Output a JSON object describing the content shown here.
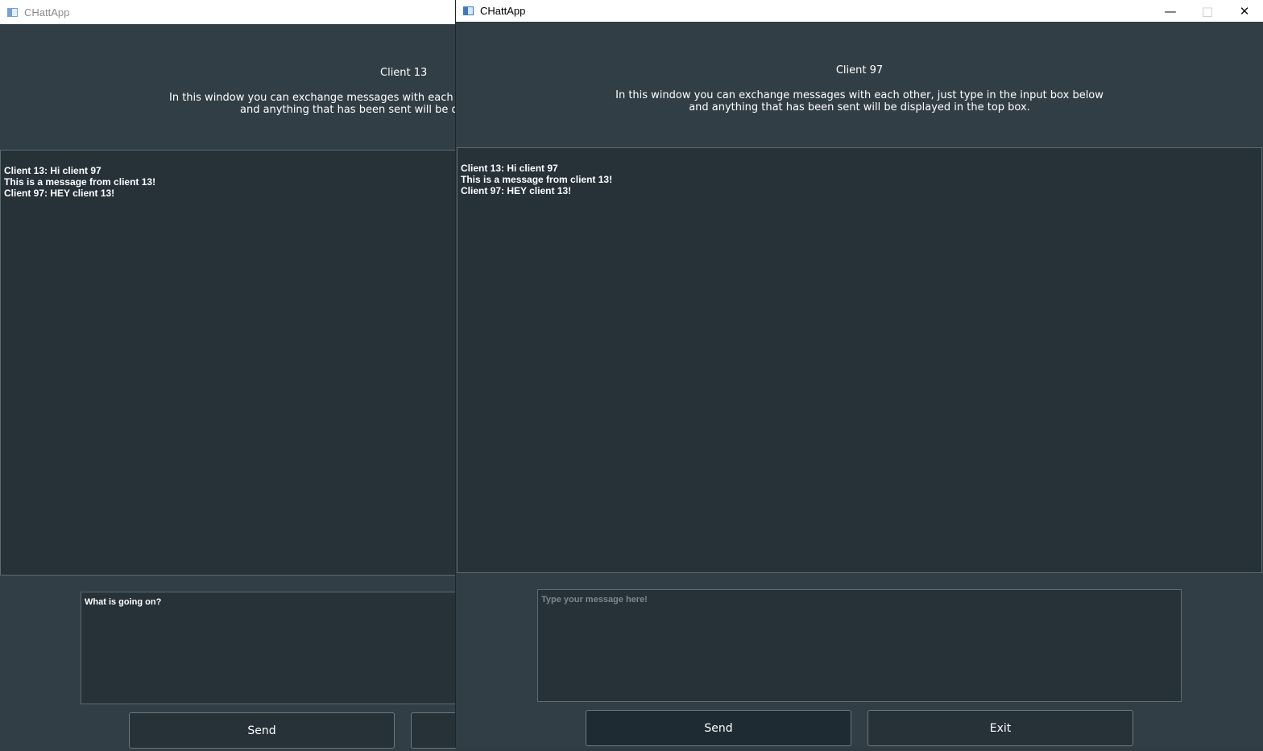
{
  "back_window": {
    "title": "CHattApp",
    "client_label": "Client 13",
    "description_line1": "In this window you can exchange messages with each oth",
    "description_line2": "and anything that has been sent will be dis",
    "messages": [
      "Client 13: Hi client 97",
      "This is a message from client 13!",
      "Client 97: HEY client 13!"
    ],
    "input_value": "What is going on?",
    "send_label": "Send"
  },
  "front_window": {
    "title": "CHattApp",
    "client_label": "Client 97",
    "description_line1": "In this window you can exchange messages with each other, just type in the input box below",
    "description_line2": "and anything that has been sent will be displayed in the top box.",
    "messages": [
      "Client 13: Hi client 97",
      "This is a message from client 13!",
      "Client 97: HEY client 13!"
    ],
    "input_placeholder": "Type your message here!",
    "send_label": "Send",
    "exit_label": "Exit",
    "controls": {
      "minimize": "—",
      "maximize": "□",
      "close": "✕"
    }
  },
  "colors": {
    "window_bg": "#323e45",
    "panel_bg": "#263138",
    "border": "#5d6a72",
    "text": "#ffffff",
    "placeholder": "#7d878d"
  }
}
